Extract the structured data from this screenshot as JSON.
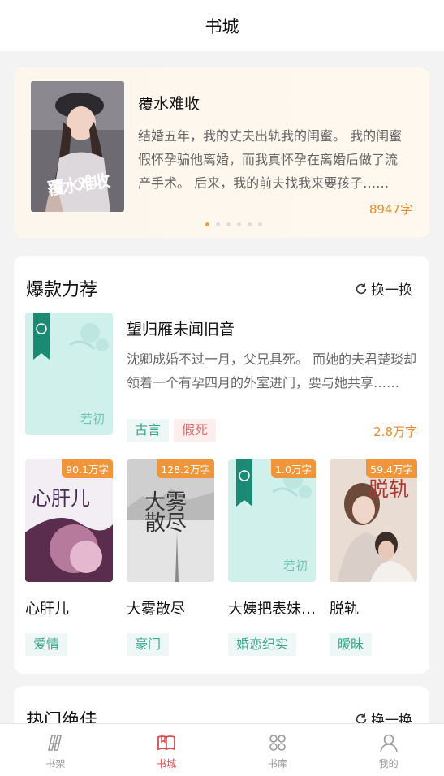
{
  "header": {
    "title": "书城"
  },
  "banner": {
    "title": "覆水难收",
    "cover_text": "覆水难收",
    "desc": "结婚五年，我的丈夫出轨我的闺蜜。 我的闺蜜假怀孕骗他离婚，而我真怀孕在离婚后做了流产手术。 后来，我的前夫找我来要孩子……",
    "count": "8947字",
    "dots": 6,
    "active_dot": 0
  },
  "section1": {
    "title": "爆款力荐",
    "refresh_label": "换一换",
    "featured": {
      "title": "望归雁未闻旧音",
      "desc": "沈卿成婚不过一月，父兄具死。 而她的夫君楚琰却领着一个有孕四月的外室进门，要与她共享……",
      "tags": [
        "古言",
        "假死"
      ],
      "count": "2.8万字",
      "cover_logo": "若初"
    },
    "grid": [
      {
        "title": "心肝儿",
        "badge": "90.1万字",
        "tag": "爱情",
        "cover_text": "心肝儿"
      },
      {
        "title": "大雾散尽",
        "badge": "128.2万字",
        "tag": "豪门",
        "cover_text": "大雾散尽"
      },
      {
        "title": "大姨把表妹送进了我家",
        "badge": "1.0万字",
        "tag": "婚恋纪实",
        "cover_text": "若初"
      },
      {
        "title": "脱轨",
        "badge": "59.4万字",
        "tag": "暧昧",
        "cover_text": "脱轨"
      }
    ]
  },
  "section2": {
    "title": "热门绝佳",
    "refresh_label": "换一换"
  },
  "tabbar": [
    {
      "label": "书架",
      "icon": "bookshelf-icon",
      "active": false
    },
    {
      "label": "书城",
      "icon": "book-open-icon",
      "active": true
    },
    {
      "label": "书库",
      "icon": "grid-icon",
      "active": false
    },
    {
      "label": "我的",
      "icon": "user-icon",
      "active": false
    }
  ],
  "colors": {
    "accent": "#e0474b",
    "count": "#e98b2f",
    "teal": "#3ba890",
    "badge": "#f0953a"
  }
}
